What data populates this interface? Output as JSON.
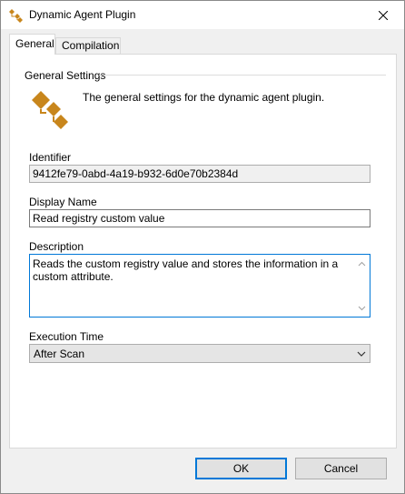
{
  "window": {
    "title": "Dynamic Agent Plugin",
    "icon": "plugin-icon"
  },
  "tabs": [
    {
      "label": "General",
      "active": true
    },
    {
      "label": "Compilation",
      "active": false
    }
  ],
  "general": {
    "group_title": "General Settings",
    "description": "The general settings for the dynamic agent plugin.",
    "identifier_label": "Identifier",
    "identifier_value": "9412fe79-0abd-4a19-b932-6d0e70b2384d",
    "display_name_label": "Display Name",
    "display_name_value": "Read registry custom value",
    "description_label": "Description",
    "description_value": "Reads the custom registry value and stores the information in a custom attribute.",
    "execution_time_label": "Execution Time",
    "execution_time_value": "After Scan"
  },
  "buttons": {
    "ok": "OK",
    "cancel": "Cancel"
  },
  "colors": {
    "accent": "#0078d7",
    "icon": "#c8861c"
  }
}
